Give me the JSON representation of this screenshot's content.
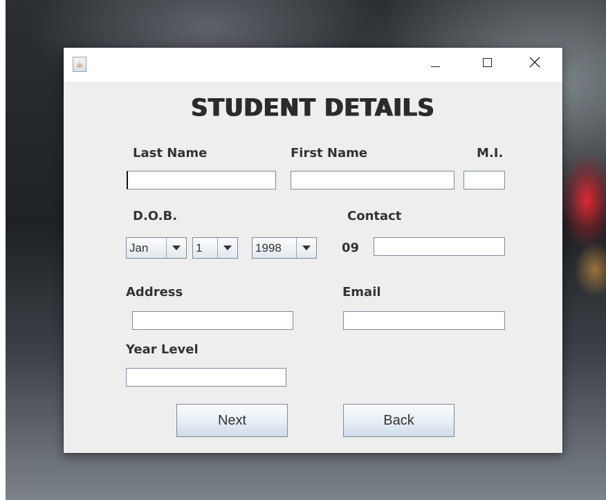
{
  "window": {
    "controls": {
      "minimize": "minimize-icon",
      "maximize": "maximize-icon",
      "close": "close-icon"
    },
    "icon": "java-app-icon"
  },
  "form": {
    "title": "STUDENT DETAILS",
    "labels": {
      "last_name": "Last Name",
      "first_name": "First Name",
      "mi": "M.I.",
      "dob": "D.O.B.",
      "contact": "Contact",
      "contact_prefix": "09",
      "address": "Address",
      "email": "Email",
      "year_level": "Year Level"
    },
    "values": {
      "last_name": "",
      "first_name": "",
      "mi": "",
      "contact": "",
      "address": "",
      "email": "",
      "year_level": ""
    },
    "dob": {
      "month": "Jan",
      "day": "1",
      "year": "1998"
    },
    "buttons": {
      "next": "Next",
      "back": "Back"
    }
  },
  "colors": {
    "window_bg": "#eeeeee",
    "titlebar_bg": "#ffffff",
    "field_border": "#7a8a99"
  }
}
